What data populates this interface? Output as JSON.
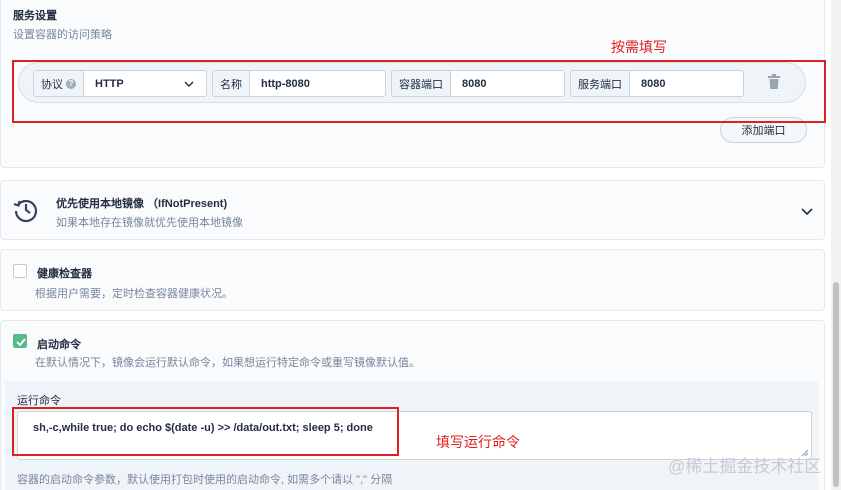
{
  "service": {
    "title": "服务设置",
    "desc": "设置容器的访问策略",
    "protocol_label": "协议",
    "protocol_help": "?",
    "protocol_value": "HTTP",
    "name_label": "名称",
    "name_value": "http-8080",
    "container_port_label": "容器端口",
    "container_port_value": "8080",
    "service_port_label": "服务端口",
    "service_port_value": "8080",
    "add_port_label": "添加端口"
  },
  "annotations": {
    "fill_as_needed": "按需填写",
    "fill_command": "填写运行命令",
    "color": "#e02020"
  },
  "pull_policy": {
    "title": "优先使用本地镜像 （IfNotPresent)",
    "desc": "如果本地存在镜像就优先使用本地镜像"
  },
  "health_check": {
    "title": "健康检查器",
    "desc": "根据用户需要，定时检查容器健康状况。",
    "checked": false
  },
  "start_command": {
    "title": "启动命令",
    "desc": "在默认情况下，镜像会运行默认命令，如果想运行特定命令或重写镜像默认值。",
    "checked": true,
    "run_label": "运行命令",
    "command_value": "sh,-c,while true; do echo $(date -u) >> /data/out.txt; sleep 5; done",
    "hint": "容器的启动命令参数，默认使用打包时使用的启动命令, 如需多个请以 \",\" 分隔"
  },
  "watermark": "@稀土掘金技术社区",
  "colors": {
    "accent_green": "#55bc8a",
    "text_primary": "#242e42",
    "text_muted": "#79879c"
  }
}
